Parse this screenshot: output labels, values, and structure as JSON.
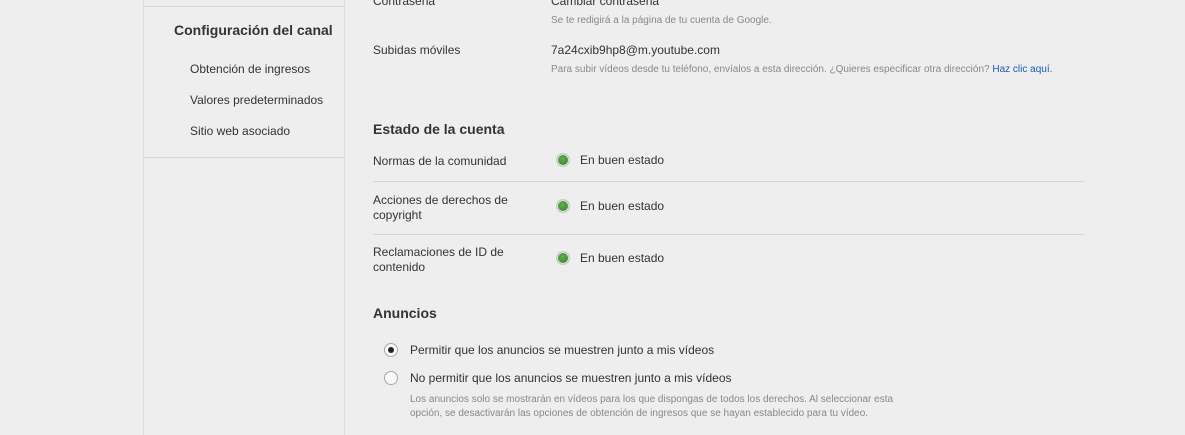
{
  "sidebar": {
    "title": "Configuración del canal",
    "items": [
      {
        "label": "Obtención de ingresos"
      },
      {
        "label": "Valores predeterminados"
      },
      {
        "label": "Sitio web asociado"
      }
    ]
  },
  "account": {
    "password_label": "Contraseña",
    "password_link": "Cambiar contraseña",
    "password_hint": "Se te redigirá a la página de tu cuenta de Google.",
    "mobile_label": "Subidas móviles",
    "mobile_email": "7a24cxib9hp8@m.youtube.com",
    "mobile_hint": "Para subir vídeos desde tu teléfono, envíalos a esta dirección. ¿Quieres especificar otra dirección?",
    "mobile_hint_link": "Haz clic aquí."
  },
  "status_section": {
    "title": "Estado de la cuenta",
    "rows": [
      {
        "label": "Normas de la comunidad",
        "status": "En buen estado"
      },
      {
        "label": "Acciones de derechos de copyright",
        "status": "En buen estado"
      },
      {
        "label": "Reclamaciones de ID de contenido",
        "status": "En buen estado"
      }
    ]
  },
  "ads_section": {
    "title": "Anuncios",
    "options": [
      {
        "label": "Permitir que los anuncios se muestren junto a mis vídeos",
        "checked": true
      },
      {
        "label": "No permitir que los anuncios se muestren junto a mis vídeos",
        "checked": false
      }
    ],
    "note": "Los anuncios solo se mostrarán en vídeos para los que dispongas de todos los derechos. Al seleccionar esta opción, se desactivarán las opciones de obtención de ingresos que se hayan establecido para tu vídeo."
  },
  "colors": {
    "link": "#1a5bb5",
    "status_ok": "#4a9a3c",
    "background": "#eeeeee"
  }
}
